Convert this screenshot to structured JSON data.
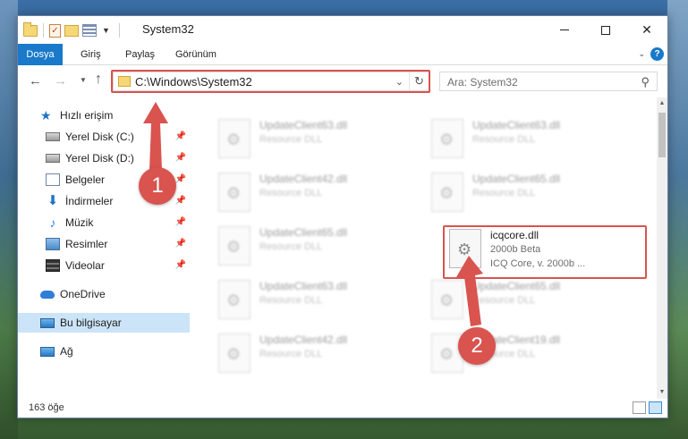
{
  "window": {
    "title": "System32"
  },
  "ribbon": {
    "tabs": [
      "Dosya",
      "Giriş",
      "Paylaş",
      "Görünüm"
    ]
  },
  "navigation": {
    "address": "C:\\Windows\\System32",
    "search_placeholder": "Ara: System32"
  },
  "sidebar": {
    "items": [
      {
        "label": "Hızlı erişim",
        "icon": "star-icon",
        "pinned": false
      },
      {
        "label": "Yerel Disk (C:)",
        "icon": "drive-icon",
        "pinned": true
      },
      {
        "label": "Yerel Disk (D:)",
        "icon": "drive-icon",
        "pinned": true
      },
      {
        "label": "Belgeler",
        "icon": "documents-icon",
        "pinned": true
      },
      {
        "label": "İndirmeler",
        "icon": "downloads-icon",
        "pinned": true
      },
      {
        "label": "Müzik",
        "icon": "music-icon",
        "pinned": true
      },
      {
        "label": "Resimler",
        "icon": "pictures-icon",
        "pinned": true
      },
      {
        "label": "Videolar",
        "icon": "videos-icon",
        "pinned": true
      },
      {
        "label": "OneDrive",
        "icon": "onedrive-icon",
        "pinned": false
      },
      {
        "label": "Bu bilgisayar",
        "icon": "this-pc-icon",
        "pinned": false,
        "selected": true
      },
      {
        "label": "Ağ",
        "icon": "network-icon",
        "pinned": false
      }
    ]
  },
  "files": {
    "left_column": [
      {
        "name": "UpdateClient63.dll",
        "type": "Resource DLL"
      },
      {
        "name": "UpdateClient42.dll",
        "type": "Resource DLL"
      },
      {
        "name": "UpdateClient65.dll",
        "type": "Resource DLL"
      },
      {
        "name": "UpdateClient63.dll",
        "type": "Resource DLL"
      },
      {
        "name": "UpdateClient42.dll",
        "type": "Resource DLL"
      }
    ],
    "right_column": [
      {
        "name": "UpdateClient63.dll",
        "type": "Resource DLL"
      },
      {
        "name": "UpdateClient65.dll",
        "type": "Resource DLL"
      },
      {
        "name": "icqcore.dll",
        "type": "2000b Beta",
        "description": "ICQ Core, v. 2000b ..."
      },
      {
        "name": "UpdateClient65.dll",
        "type": "Resource DLL"
      },
      {
        "name": "UpdateClient19.dll",
        "type": "Resource DLL"
      }
    ]
  },
  "status": {
    "item_count": "163 öğe"
  },
  "annotations": {
    "step1": "1",
    "step2": "2",
    "color": "#d9534f"
  }
}
